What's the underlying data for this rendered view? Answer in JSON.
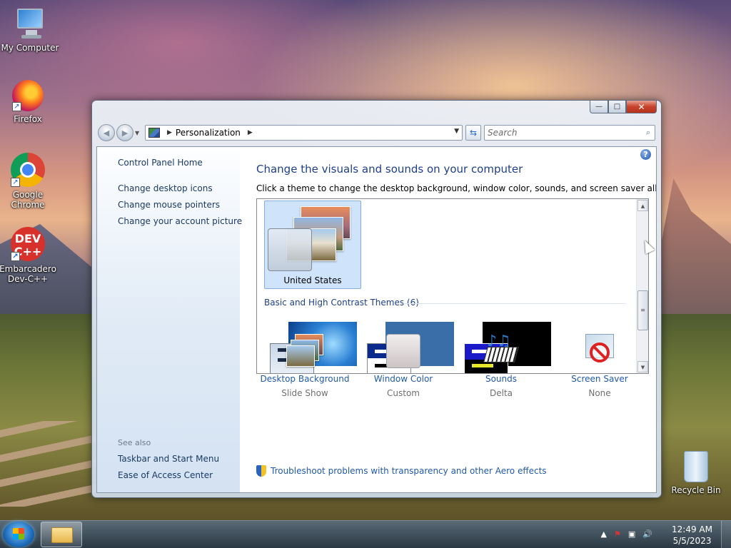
{
  "desktop": {
    "icons": [
      {
        "label": "My Computer",
        "icon": "my-computer-icon"
      },
      {
        "label": "Firefox",
        "icon": "firefox-icon"
      },
      {
        "label": "Google Chrome",
        "icon": "chrome-icon"
      },
      {
        "label": "Embarcadero Dev-C++",
        "icon": "devcpp-icon",
        "logo_text": "DEV C++"
      },
      {
        "label": "Recycle Bin",
        "icon": "recycle-bin-icon"
      }
    ]
  },
  "window": {
    "title_buttons": {
      "minimize": "—",
      "maximize": "□",
      "close": "✕"
    },
    "nav": {
      "back": "◀",
      "forward": "▶",
      "breadcrumb": "Personalization",
      "search_placeholder": "Search"
    },
    "sidebar": {
      "links": [
        "Control Panel Home",
        "Change desktop icons",
        "Change mouse pointers",
        "Change your account picture"
      ],
      "see_also_label": "See also",
      "see_also": [
        "Taskbar and Start Menu",
        "Ease of Access Center"
      ]
    },
    "main": {
      "heading": "Change the visuals and sounds on your computer",
      "subheading": "Click a theme to change the desktop background, window color, sounds, and screen saver all at once.",
      "selected_theme": "United States",
      "basic_section": "Basic and High Contrast Themes (6)",
      "bottom_items": [
        {
          "name": "Desktop Background",
          "value": "Slide Show"
        },
        {
          "name": "Window Color",
          "value": "Custom"
        },
        {
          "name": "Sounds",
          "value": "Delta"
        },
        {
          "name": "Screen Saver",
          "value": "None"
        }
      ],
      "troubleshoot": "Troubleshoot problems with transparency and other Aero effects",
      "help": "?"
    }
  },
  "taskbar": {
    "time": "12:49 AM",
    "date": "5/5/2023",
    "tray": [
      "▲",
      "⚑",
      "▣",
      "🔊"
    ]
  },
  "colors": {
    "link": "#1f5aa8",
    "heading": "#1e3f8a",
    "selection": "#cfe3fb"
  }
}
